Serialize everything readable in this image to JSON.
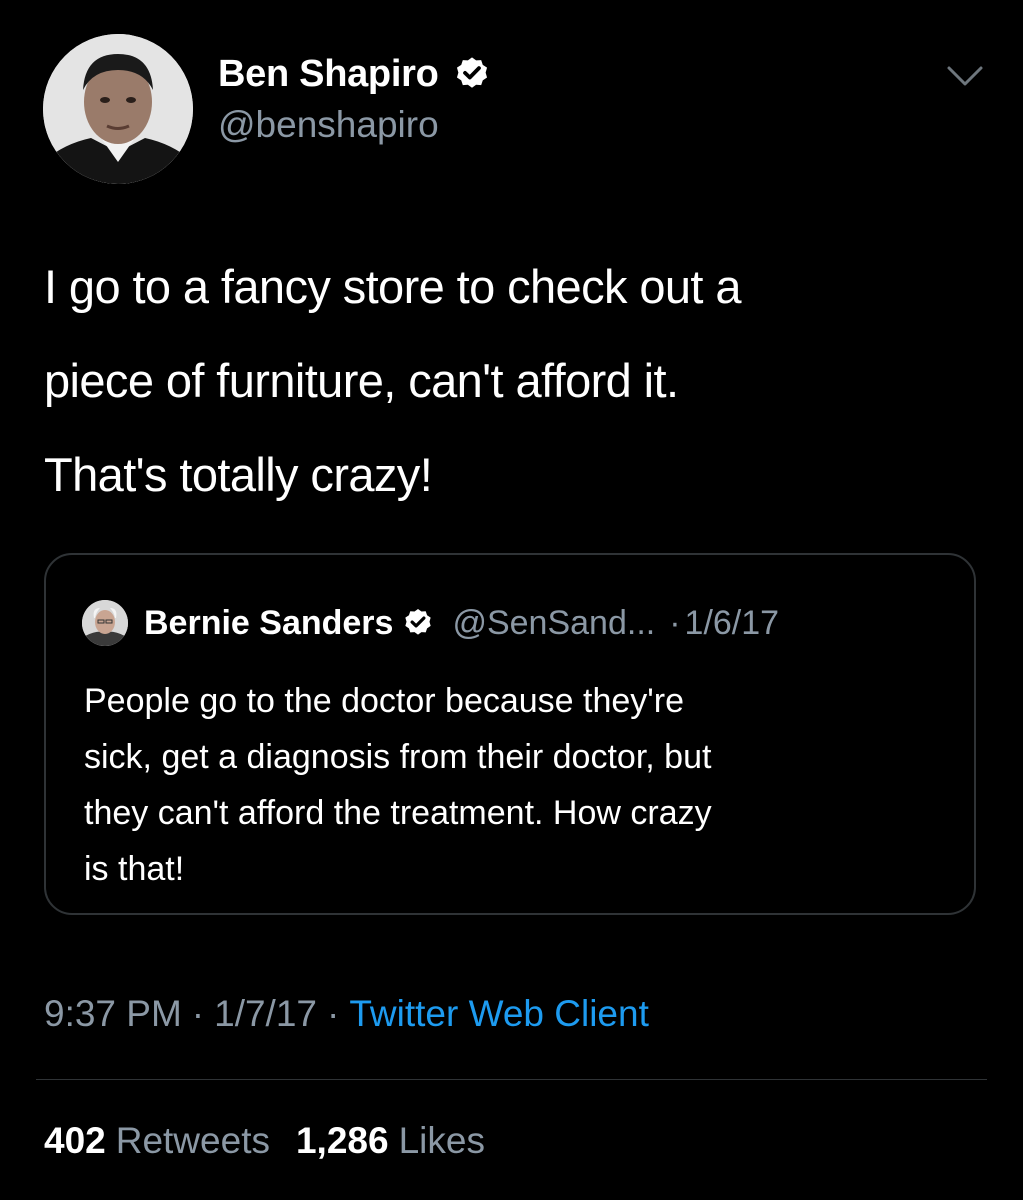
{
  "author": {
    "name": "Ben Shapiro",
    "handle": "@benshapiro",
    "verified": true
  },
  "tweet": {
    "text_lines": [
      "I go to a fancy store to check out a",
      "piece of furniture, can't afford it.",
      "That's totally crazy!"
    ]
  },
  "quoted_tweet": {
    "name": "Bernie Sanders",
    "handle": "@SenSand...",
    "separator": "·",
    "date": "1/6/17",
    "verified": true,
    "text_lines": [
      "People go to the doctor because they're",
      "sick, get a diagnosis from their doctor, but",
      "they can't afford the treatment. How crazy",
      "is that!"
    ]
  },
  "meta": {
    "time": "9:37 PM",
    "separator": "·",
    "date": "1/7/17",
    "source": "Twitter Web Client"
  },
  "stats": {
    "retweets_count": "402",
    "retweets_label": "Retweets",
    "likes_count": "1,286",
    "likes_label": "Likes"
  },
  "icons": {
    "verified": "verified-badge-icon",
    "more": "chevron-down-icon"
  },
  "colors": {
    "background": "#000000",
    "text_primary": "#ffffff",
    "text_secondary": "#8b98a5",
    "link": "#1d9bf0",
    "border": "#2f3336"
  }
}
